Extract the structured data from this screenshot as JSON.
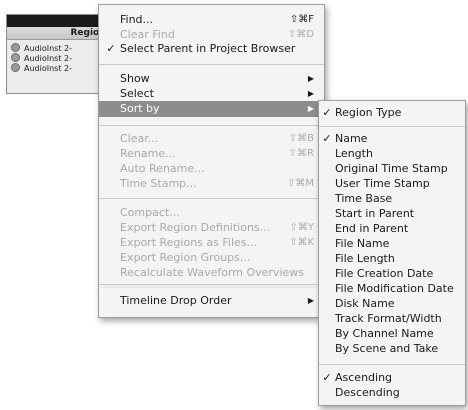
{
  "regions_panel": {
    "header": "Regions",
    "rows": [
      "AudioInst 2-",
      "AudioInst 2-",
      "AudioInst 2-"
    ]
  },
  "main_menu": {
    "find": {
      "label": "Find...",
      "shortcut": "⇧⌘F"
    },
    "clear_find": {
      "label": "Clear Find",
      "shortcut": "⇧⌘D"
    },
    "select_parent": {
      "label": "Select Parent in Project Browser",
      "check": "✓"
    },
    "show": {
      "label": "Show"
    },
    "select": {
      "label": "Select"
    },
    "sort_by": {
      "label": "Sort by"
    },
    "clear": {
      "label": "Clear...",
      "shortcut": "⇧⌘B"
    },
    "rename": {
      "label": "Rename...",
      "shortcut": "⇧⌘R"
    },
    "auto_rename": {
      "label": "Auto Rename..."
    },
    "time_stamp": {
      "label": "Time Stamp...",
      "shortcut": "⇧⌘M"
    },
    "compact": {
      "label": "Compact..."
    },
    "export_defs": {
      "label": "Export Region Definitions...",
      "shortcut": "⇧⌘Y"
    },
    "export_files": {
      "label": "Export Regions as Files...",
      "shortcut": "⇧⌘K"
    },
    "export_groups": {
      "label": "Export Region Groups..."
    },
    "recalculate": {
      "label": "Recalculate Waveform Overviews"
    },
    "timeline_drop": {
      "label": "Timeline Drop Order"
    }
  },
  "sort_submenu": {
    "region_type": {
      "label": "Region Type",
      "check": "✓"
    },
    "fields": [
      {
        "label": "Name",
        "check": "✓"
      },
      {
        "label": "Length",
        "check": ""
      },
      {
        "label": "Original Time Stamp",
        "check": ""
      },
      {
        "label": "User Time Stamp",
        "check": ""
      },
      {
        "label": "Time Base",
        "check": ""
      },
      {
        "label": "Start in Parent",
        "check": ""
      },
      {
        "label": "End in Parent",
        "check": ""
      },
      {
        "label": "File Name",
        "check": ""
      },
      {
        "label": "File Length",
        "check": ""
      },
      {
        "label": "File Creation Date",
        "check": ""
      },
      {
        "label": "File Modification Date",
        "check": ""
      },
      {
        "label": "Disk Name",
        "check": ""
      },
      {
        "label": "Track Format/Width",
        "check": ""
      },
      {
        "label": "By Channel Name",
        "check": ""
      },
      {
        "label": "By Scene and Take",
        "check": ""
      }
    ],
    "order": [
      {
        "label": "Ascending",
        "check": "✓"
      },
      {
        "label": "Descending",
        "check": ""
      }
    ]
  },
  "icons": {
    "submenu_arrow": "triangle-right-icon",
    "check": "checkmark-icon",
    "region_dot": "circle-icon"
  }
}
